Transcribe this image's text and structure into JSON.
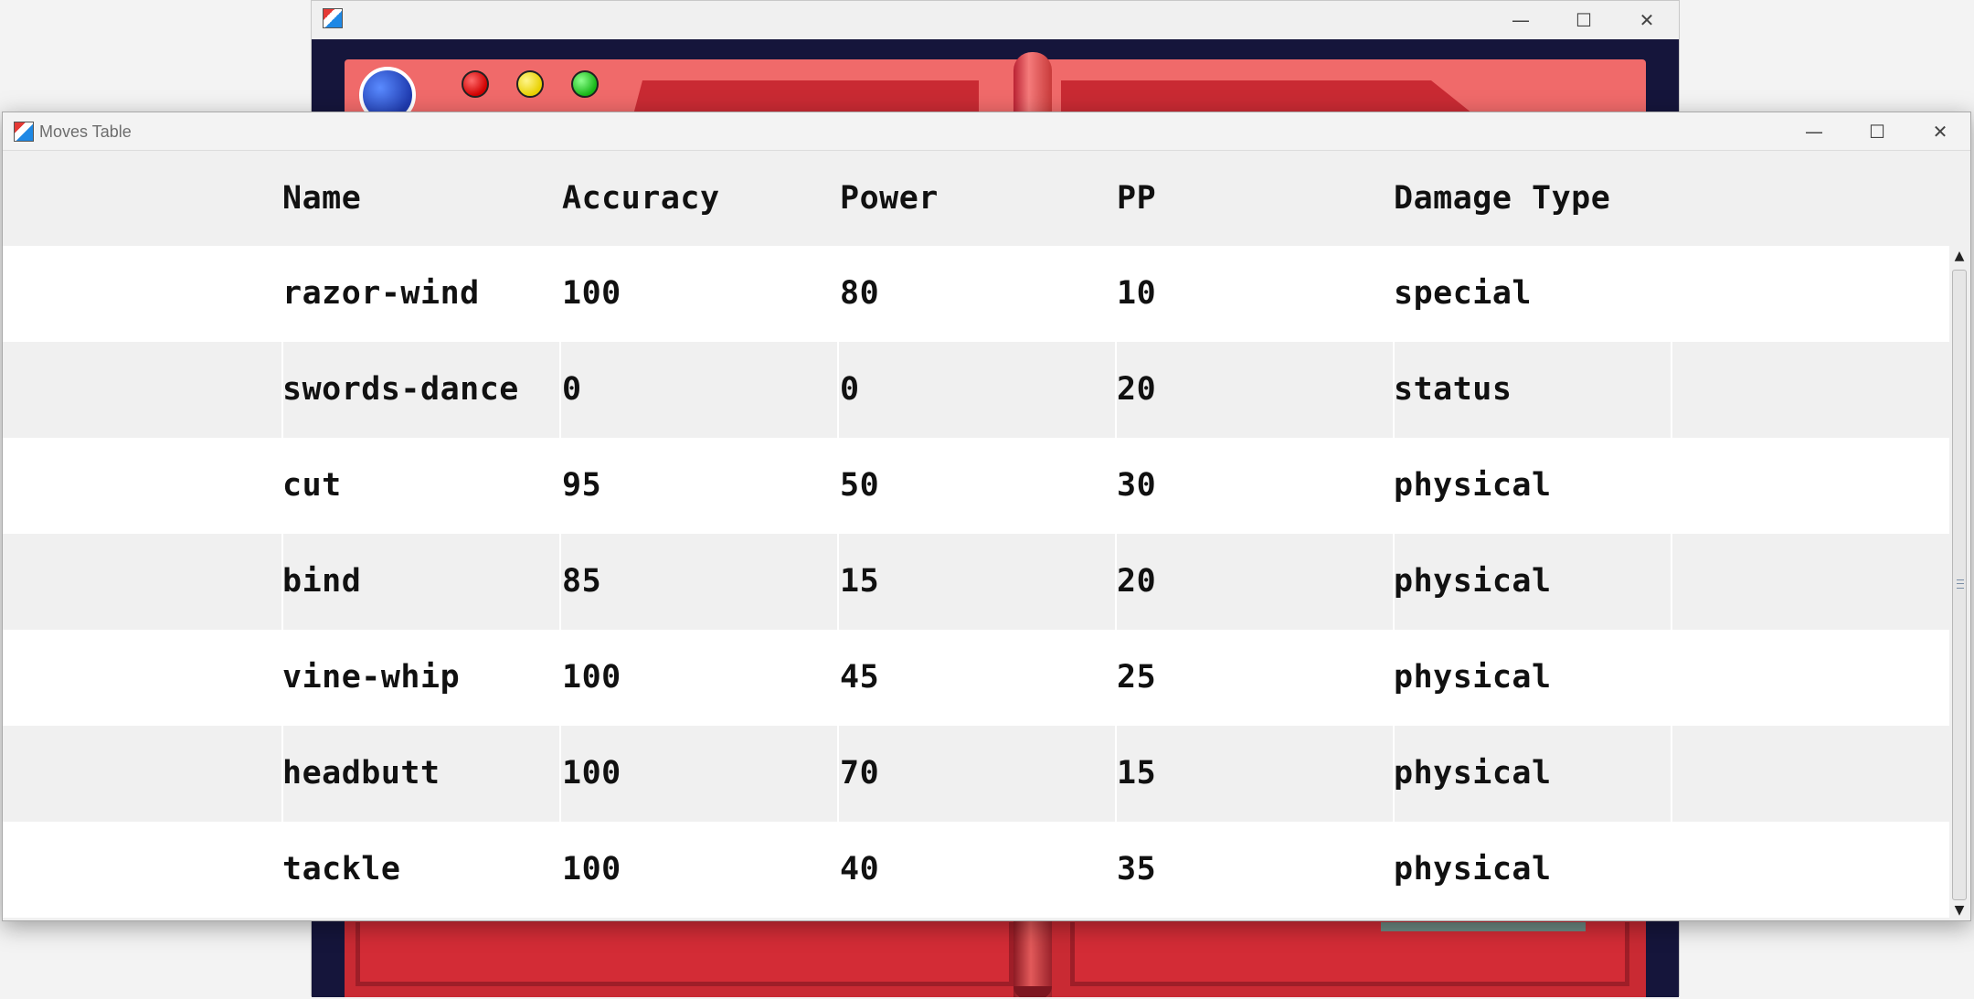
{
  "background_window": {
    "minimize_glyph": "—",
    "maximize_glyph": "☐",
    "close_glyph": "✕"
  },
  "moves_window": {
    "title": "Moves Table",
    "minimize_glyph": "—",
    "maximize_glyph": "☐",
    "close_glyph": "✕"
  },
  "table": {
    "columns": [
      "Name",
      "Accuracy",
      "Power",
      "PP",
      "Damage Type"
    ],
    "rows": [
      {
        "name": "razor-wind",
        "accuracy": "100",
        "power": "80",
        "pp": "10",
        "damage_type": "special"
      },
      {
        "name": "swords-dance",
        "accuracy": "0",
        "power": "0",
        "pp": "20",
        "damage_type": "status"
      },
      {
        "name": "cut",
        "accuracy": "95",
        "power": "50",
        "pp": "30",
        "damage_type": "physical"
      },
      {
        "name": "bind",
        "accuracy": "85",
        "power": "15",
        "pp": "20",
        "damage_type": "physical"
      },
      {
        "name": "vine-whip",
        "accuracy": "100",
        "power": "45",
        "pp": "25",
        "damage_type": "physical"
      },
      {
        "name": "headbutt",
        "accuracy": "100",
        "power": "70",
        "pp": "15",
        "damage_type": "physical"
      },
      {
        "name": "tackle",
        "accuracy": "100",
        "power": "40",
        "pp": "35",
        "damage_type": "physical"
      }
    ]
  },
  "scrollbar": {
    "up_glyph": "▲",
    "down_glyph": "▼"
  },
  "colors": {
    "pokedex_red": "#c92a33",
    "pokedex_light_red": "#f06a6a",
    "pokedex_background": "#15153b",
    "row_alt": "#f0f0f0"
  }
}
